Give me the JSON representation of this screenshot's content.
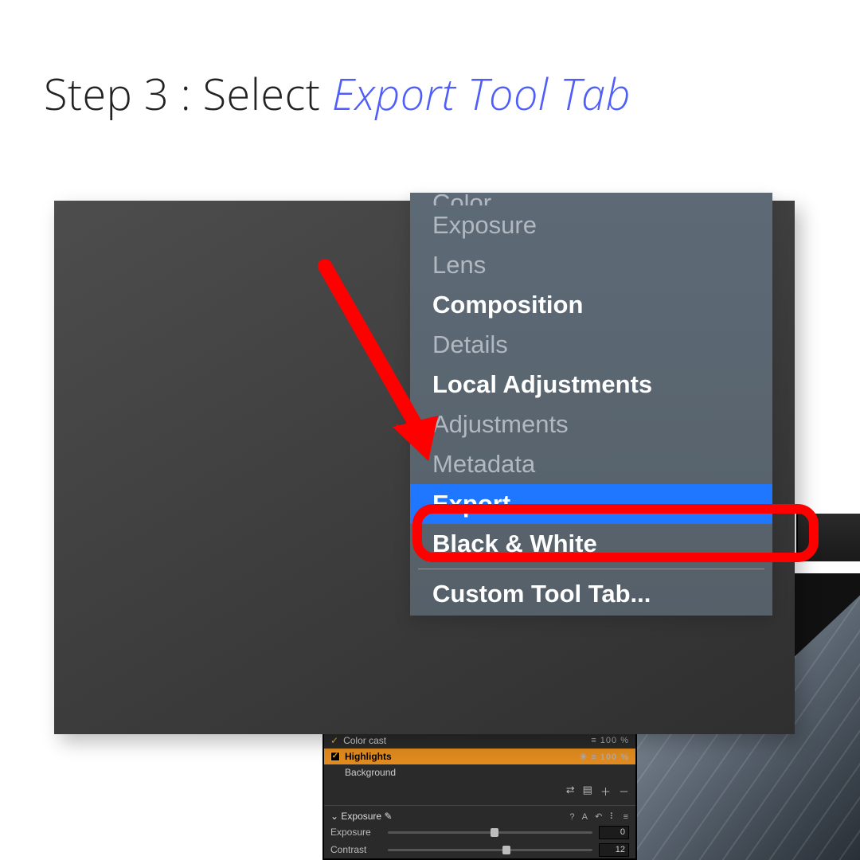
{
  "heading": {
    "prefix": "Step 3 :  Select ",
    "emphasis": "Export Tool Tab"
  },
  "menu": {
    "partial_top": "Color",
    "items": [
      {
        "label": "Exposure",
        "bold": false
      },
      {
        "label": "Lens",
        "bold": false
      },
      {
        "label": "Composition",
        "bold": true
      },
      {
        "label": "Details",
        "bold": false
      },
      {
        "label": "Local Adjustments",
        "bold": true
      },
      {
        "label": "Adjustments",
        "bold": false
      },
      {
        "label": "Metadata",
        "bold": false
      },
      {
        "label": "Export",
        "bold": true,
        "highlighted": true
      },
      {
        "label": "Black & White",
        "bold": true
      }
    ],
    "footer": "Custom Tool Tab..."
  },
  "panel": {
    "row1": {
      "label": "Color cast",
      "value": "100 %"
    },
    "row2": {
      "label": "Highlights",
      "value": "100 %"
    },
    "row3": {
      "label": "Background"
    },
    "section": {
      "title": "Exposure",
      "sliders": [
        {
          "label": "Exposure",
          "value": "0",
          "pos": 0.5
        },
        {
          "label": "Contrast",
          "value": "12",
          "pos": 0.56
        }
      ]
    }
  }
}
